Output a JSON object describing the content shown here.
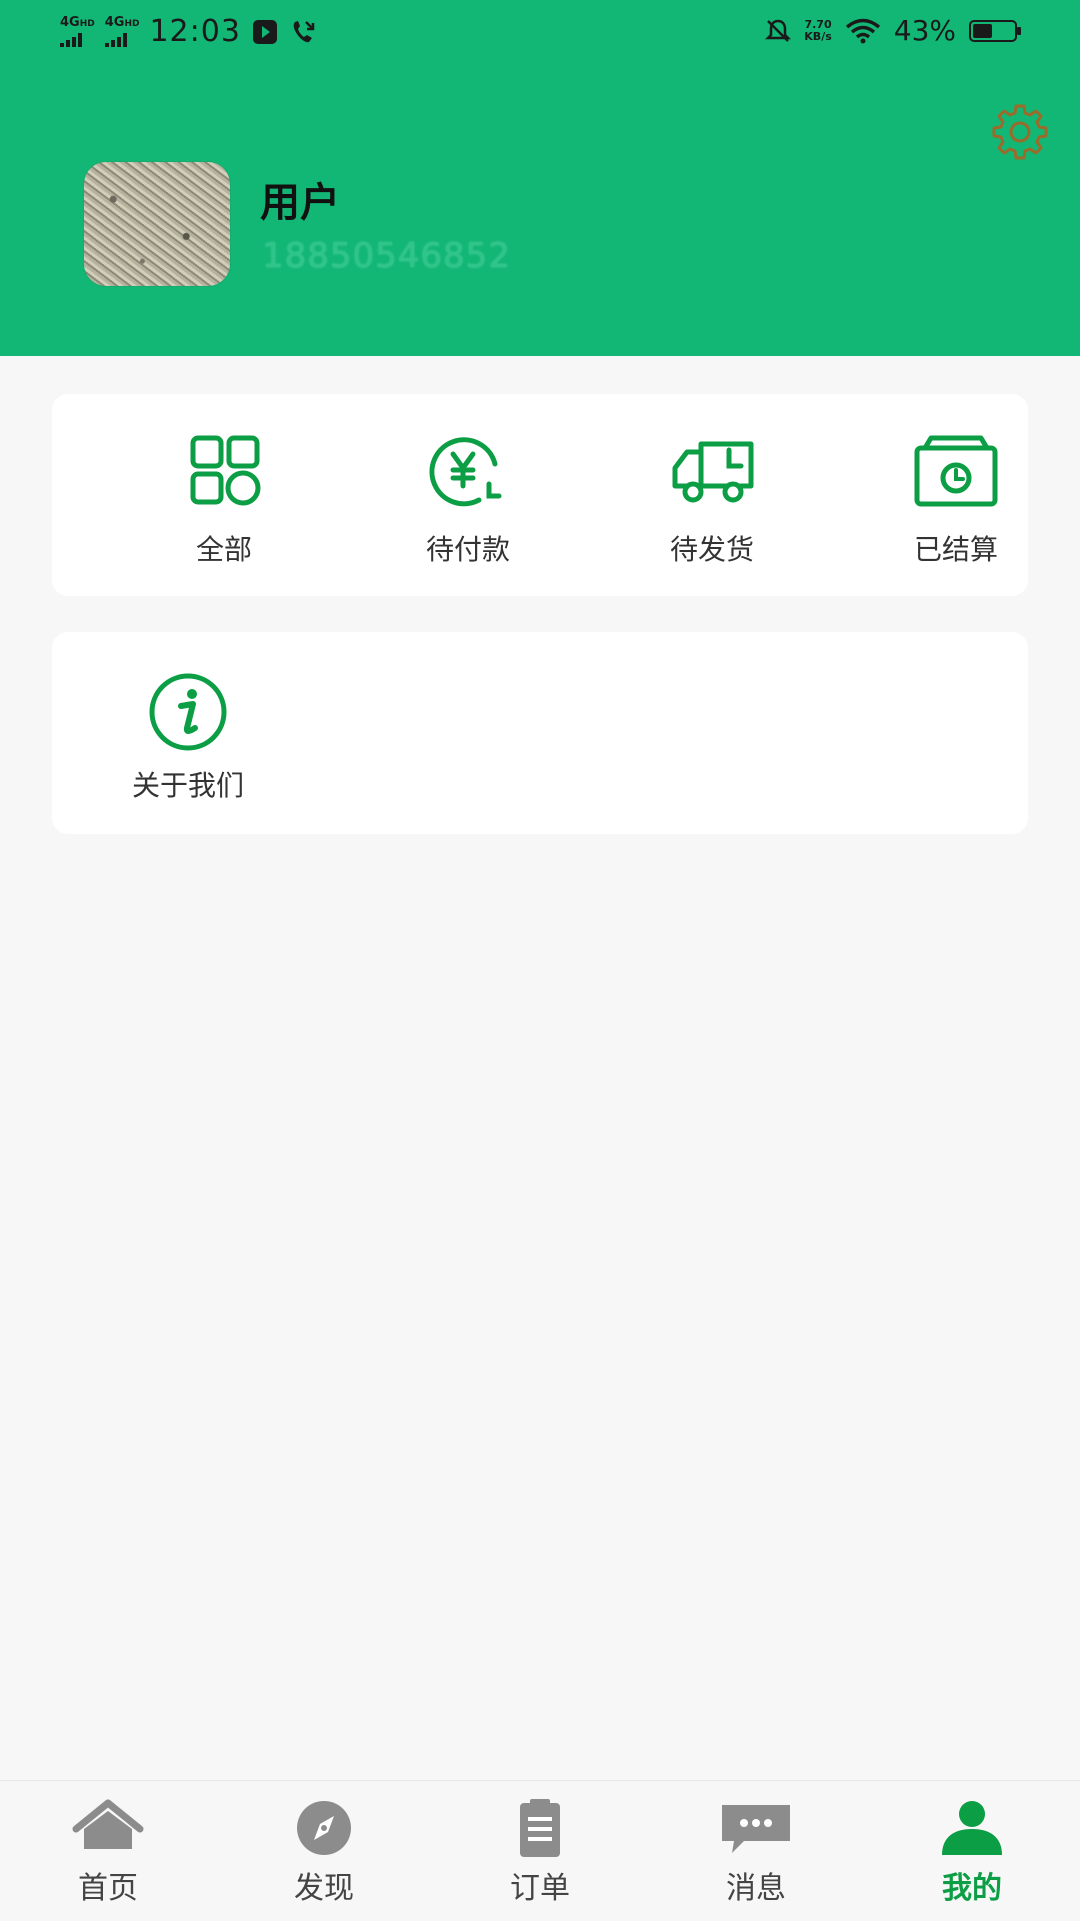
{
  "status_bar": {
    "network1": "4G",
    "network1_sup": "HD",
    "network2": "4G",
    "network2_sup": "HD",
    "time": "12:03",
    "speed_value": "7.70",
    "speed_unit": "KB/s",
    "battery_percent": "43%"
  },
  "profile": {
    "name": "用户",
    "phone": "18850546852"
  },
  "orders": {
    "items": [
      {
        "label": "全部",
        "icon": "grid-icon"
      },
      {
        "label": "待付款",
        "icon": "yen-payment-icon"
      },
      {
        "label": "待发货",
        "icon": "truck-icon"
      },
      {
        "label": "已结算",
        "icon": "settled-box-icon"
      }
    ]
  },
  "services": {
    "about_label": "关于我们",
    "about_icon": "info-icon"
  },
  "tabbar": {
    "items": [
      {
        "label": "首页",
        "icon": "home-icon"
      },
      {
        "label": "发现",
        "icon": "compass-icon"
      },
      {
        "label": "订单",
        "icon": "clipboard-icon"
      },
      {
        "label": "消息",
        "icon": "chat-icon"
      },
      {
        "label": "我的",
        "icon": "person-icon"
      }
    ],
    "active": "我的"
  },
  "colors": {
    "brand_green": "#13b775",
    "icon_green": "#0c9e44",
    "gear_brown": "#9a6b2a",
    "tab_inactive": "#8c8c8c"
  }
}
